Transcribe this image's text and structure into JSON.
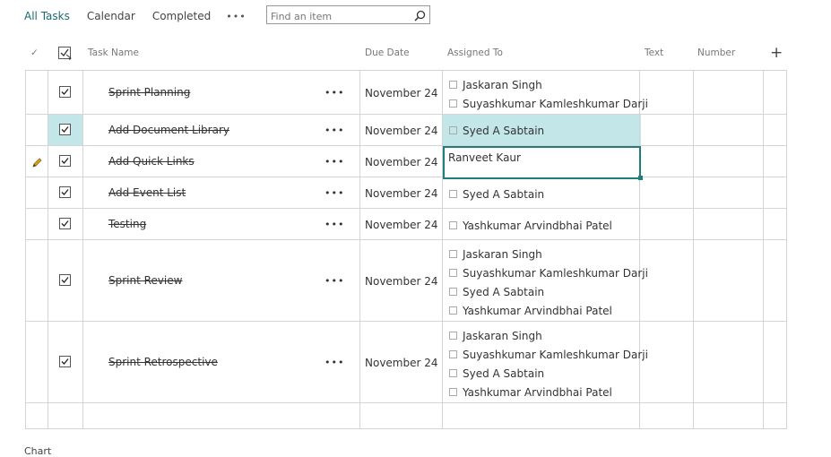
{
  "views": {
    "all_tasks": "All Tasks",
    "calendar": "Calendar",
    "completed": "Completed",
    "more": "•••"
  },
  "search": {
    "placeholder": "Find an item",
    "icon": "search-icon"
  },
  "columns": {
    "check": "✓",
    "task_name": "Task Name",
    "due_date": "Due Date",
    "assigned_to": "Assigned To",
    "text": "Text",
    "number": "Number",
    "add": "+"
  },
  "rows": [
    {
      "task": "Sprint Planning",
      "due": "November 24",
      "assigned": [
        "Jaskaran Singh",
        "Suyashkumar Kamleshkumar Darji"
      ],
      "completed": true
    },
    {
      "task": "Add Document Library",
      "due": "November 24",
      "assigned": [
        "Syed A Sabtain"
      ],
      "completed": true,
      "selected": true
    },
    {
      "task": "Add Quick Links",
      "due": "November 24",
      "assigned_editing": "Ranveet Kaur",
      "completed": true,
      "editing": true
    },
    {
      "task": "Add Event List",
      "due": "November 24",
      "assigned": [
        "Syed A Sabtain"
      ],
      "completed": true
    },
    {
      "task": "Testing",
      "due": "November 24",
      "assigned": [
        "Yashkumar Arvindbhai Patel"
      ],
      "completed": true
    },
    {
      "task": "Sprint Review",
      "due": "November 24",
      "assigned": [
        "Jaskaran Singh",
        "Suyashkumar Kamleshkumar Darji",
        "Syed A Sabtain",
        "Yashkumar Arvindbhai Patel"
      ],
      "completed": true
    },
    {
      "task": "Sprint Retrospective",
      "due": "November 24",
      "assigned": [
        "Jaskaran Singh",
        "Suyashkumar Kamleshkumar Darji",
        "Syed A Sabtain",
        "Yashkumar Arvindbhai Patel"
      ],
      "completed": true
    }
  ],
  "row_more": "•••",
  "footer": {
    "text": "Chart"
  },
  "colors": {
    "accent": "#1e7e7b",
    "selected_row": "#c3e6e8",
    "active_view": "#1a6b70"
  }
}
